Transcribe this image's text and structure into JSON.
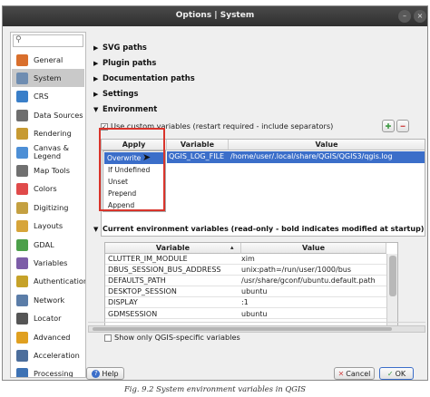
{
  "window": {
    "title": "Options | System"
  },
  "sidebar": {
    "items": [
      {
        "label": "General",
        "icon": "general-icon",
        "color": "#d96f2c"
      },
      {
        "label": "System",
        "icon": "system-icon",
        "color": "#6f8db1",
        "selected": true
      },
      {
        "label": "CRS",
        "icon": "crs-icon",
        "color": "#3a7fc9"
      },
      {
        "label": "Data Sources",
        "icon": "data-sources-icon",
        "color": "#6e6e6e"
      },
      {
        "label": "Rendering",
        "icon": "rendering-icon",
        "color": "#c79a32"
      },
      {
        "label": "Canvas & Legend",
        "icon": "canvas-legend-icon",
        "color": "#4d8fd6"
      },
      {
        "label": "Map Tools",
        "icon": "map-tools-icon",
        "color": "#707070"
      },
      {
        "label": "Colors",
        "icon": "colors-icon",
        "color": "#e04a4a"
      },
      {
        "label": "Digitizing",
        "icon": "digitizing-icon",
        "color": "#c4a041"
      },
      {
        "label": "Layouts",
        "icon": "layouts-icon",
        "color": "#d7a53a"
      },
      {
        "label": "GDAL",
        "icon": "gdal-icon",
        "color": "#4ca04a"
      },
      {
        "label": "Variables",
        "icon": "variables-icon",
        "color": "#7d5da8"
      },
      {
        "label": "Authentication",
        "icon": "authentication-icon",
        "color": "#c6a229"
      },
      {
        "label": "Network",
        "icon": "network-icon",
        "color": "#5b7da8"
      },
      {
        "label": "Locator",
        "icon": "locator-icon",
        "color": "#555555"
      },
      {
        "label": "Advanced",
        "icon": "advanced-icon",
        "color": "#e0a020"
      },
      {
        "label": "Acceleration",
        "icon": "acceleration-icon",
        "color": "#4c6e9c"
      },
      {
        "label": "Processing",
        "icon": "processing-icon",
        "color": "#3d72b4"
      }
    ]
  },
  "sections": {
    "svg_paths": "SVG paths",
    "plugin_paths": "Plugin paths",
    "documentation_paths": "Documentation paths",
    "settings": "Settings",
    "environment": "Environment"
  },
  "environment": {
    "use_custom": "Use custom variables (restart required - include separators)",
    "headers": {
      "apply": "Apply",
      "variable": "Variable",
      "value": "Value"
    },
    "row": {
      "apply": "Overwrite",
      "variable": "QGIS_LOG_FILE",
      "value": "/home/user/.local/share/QGIS/QGIS3/qgis.log"
    },
    "dropdown": [
      "Overwrite",
      "If Undefined",
      "Unset",
      "Prepend",
      "Append"
    ]
  },
  "current": {
    "title": "Current environment variables (read-only - bold indicates modified at startup)",
    "headers": {
      "variable": "Variable",
      "value": "Value"
    },
    "rows": [
      {
        "variable": "CLUTTER_IM_MODULE",
        "value": "xim"
      },
      {
        "variable": "DBUS_SESSION_BUS_ADDRESS",
        "value": "unix:path=/run/user/1000/bus"
      },
      {
        "variable": "DEFAULTS_PATH",
        "value": "/usr/share/gconf/ubuntu.default.path"
      },
      {
        "variable": "DESKTOP_SESSION",
        "value": "ubuntu"
      },
      {
        "variable": "DISPLAY",
        "value": ":1"
      },
      {
        "variable": "GDMSESSION",
        "value": "ubuntu"
      }
    ],
    "show_only": "Show only QGIS-specific variables"
  },
  "buttons": {
    "help": "Help",
    "cancel": "Cancel",
    "ok": "OK"
  },
  "caption": "Fig. 9.2 System environment variables in QGIS",
  "colors": {
    "highlight": "#3b6ec9",
    "callout": "#d9342b",
    "add": "#3e9a44",
    "remove": "#d04848"
  }
}
